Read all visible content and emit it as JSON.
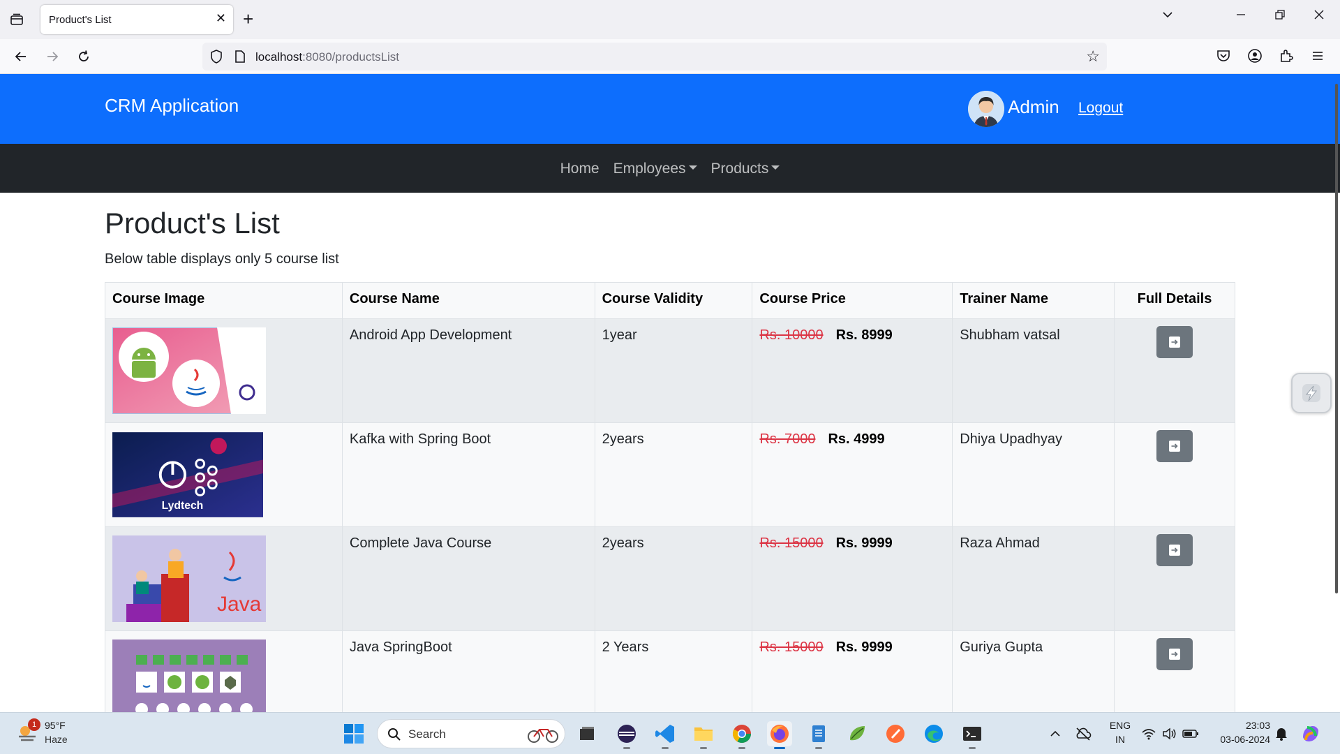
{
  "browser": {
    "tab_title": "Product's List",
    "url_host": "localhost",
    "url_rest": ":8080/productsList"
  },
  "header": {
    "brand": "CRM Application",
    "user_name": "Admin",
    "logout_label": "Logout"
  },
  "menu": {
    "home": "Home",
    "employees": "Employees",
    "products": "Products"
  },
  "page": {
    "title": "Product's List",
    "description": "Below table displays only 5 course list"
  },
  "table": {
    "headers": [
      "Course Image",
      "Course Name",
      "Course Validity",
      "Course Price",
      "Trainer Name",
      "Full Details"
    ],
    "rows": [
      {
        "name": "Android App Development",
        "validity": "1year",
        "old_price": "Rs. 10000",
        "new_price": "Rs. 8999",
        "trainer": "Shubham vatsal",
        "image": "android-java-course-image"
      },
      {
        "name": "Kafka with Spring Boot",
        "validity": "2years",
        "old_price": "Rs. 7000",
        "new_price": "Rs. 4999",
        "trainer": "Dhiya Upadhyay",
        "image": "kafka-spring-course-image",
        "image_caption": "Lydtech"
      },
      {
        "name": "Complete Java Course",
        "validity": "2years",
        "old_price": "Rs. 15000",
        "new_price": "Rs. 9999",
        "trainer": "Raza Ahmad",
        "image": "java-course-image",
        "image_caption": "Java"
      },
      {
        "name": "Java SpringBoot",
        "validity": "2 Years",
        "old_price": "Rs. 15000",
        "new_price": "Rs. 9999",
        "trainer": "Guriya Gupta",
        "image": "springboot-course-image"
      }
    ]
  },
  "taskbar": {
    "weather_temp": "95°F",
    "weather_desc": "Haze",
    "weather_badge": "1",
    "search_placeholder": "Search",
    "lang_top": "ENG",
    "lang_bottom": "IN",
    "time": "23:03",
    "date": "03-06-2024"
  },
  "colors": {
    "header_bg": "#0d6efd",
    "menu_bg": "#212529",
    "old_price": "#dc3545",
    "detail_button": "#6c757d"
  }
}
